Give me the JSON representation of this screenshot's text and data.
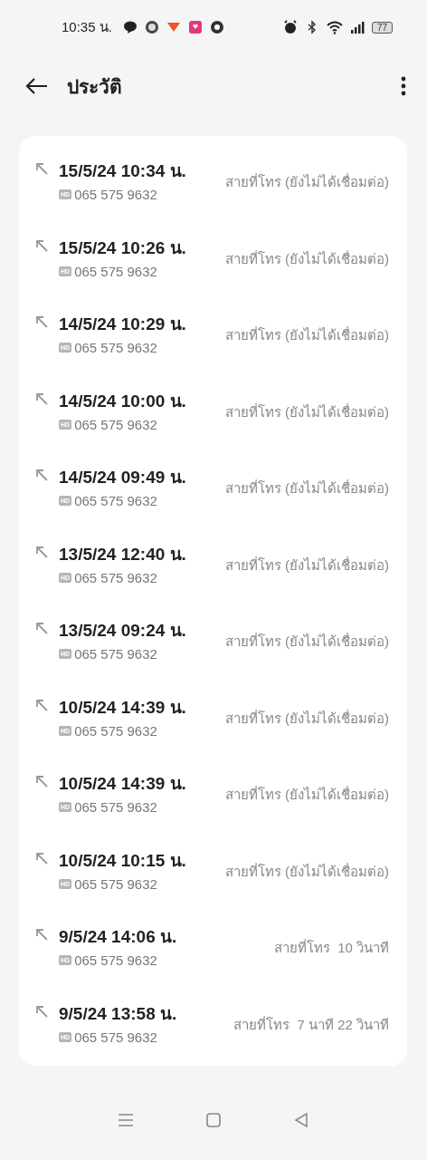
{
  "status_bar": {
    "time": "10:35 น.",
    "battery": "77"
  },
  "header": {
    "title": "ประวัติ"
  },
  "calls": [
    {
      "date": "15/5/24 10:34 น.",
      "badge": "HD",
      "number": "065 575 9632",
      "status": "สายที่โทร (ยังไม่ได้เชื่อมต่อ)"
    },
    {
      "date": "15/5/24 10:26 น.",
      "badge": "HD",
      "number": "065 575 9632",
      "status": "สายที่โทร (ยังไม่ได้เชื่อมต่อ)"
    },
    {
      "date": "14/5/24 10:29 น.",
      "badge": "HD",
      "number": "065 575 9632",
      "status": "สายที่โทร (ยังไม่ได้เชื่อมต่อ)"
    },
    {
      "date": "14/5/24 10:00 น.",
      "badge": "HD",
      "number": "065 575 9632",
      "status": "สายที่โทร (ยังไม่ได้เชื่อมต่อ)"
    },
    {
      "date": "14/5/24 09:49 น.",
      "badge": "HD",
      "number": "065 575 9632",
      "status": "สายที่โทร (ยังไม่ได้เชื่อมต่อ)"
    },
    {
      "date": "13/5/24 12:40 น.",
      "badge": "HD",
      "number": "065 575 9632",
      "status": "สายที่โทร (ยังไม่ได้เชื่อมต่อ)"
    },
    {
      "date": "13/5/24 09:24 น.",
      "badge": "HD",
      "number": "065 575 9632",
      "status": "สายที่โทร (ยังไม่ได้เชื่อมต่อ)"
    },
    {
      "date": "10/5/24 14:39 น.",
      "badge": "HD",
      "number": "065 575 9632",
      "status": "สายที่โทร (ยังไม่ได้เชื่อมต่อ)"
    },
    {
      "date": "10/5/24 14:39 น.",
      "badge": "HD",
      "number": "065 575 9632",
      "status": "สายที่โทร (ยังไม่ได้เชื่อมต่อ)"
    },
    {
      "date": "10/5/24 10:15 น.",
      "badge": "HD",
      "number": "065 575 9632",
      "status": "สายที่โทร (ยังไม่ได้เชื่อมต่อ)"
    },
    {
      "date": "9/5/24 14:06 น.",
      "badge": "HD",
      "number": "065 575 9632",
      "status": "สายที่โทร  10 วินาที"
    },
    {
      "date": "9/5/24 13:58 น.",
      "badge": "HD",
      "number": "065 575 9632",
      "status": "สายที่โทร  7 นาที 22 วินาที"
    }
  ]
}
